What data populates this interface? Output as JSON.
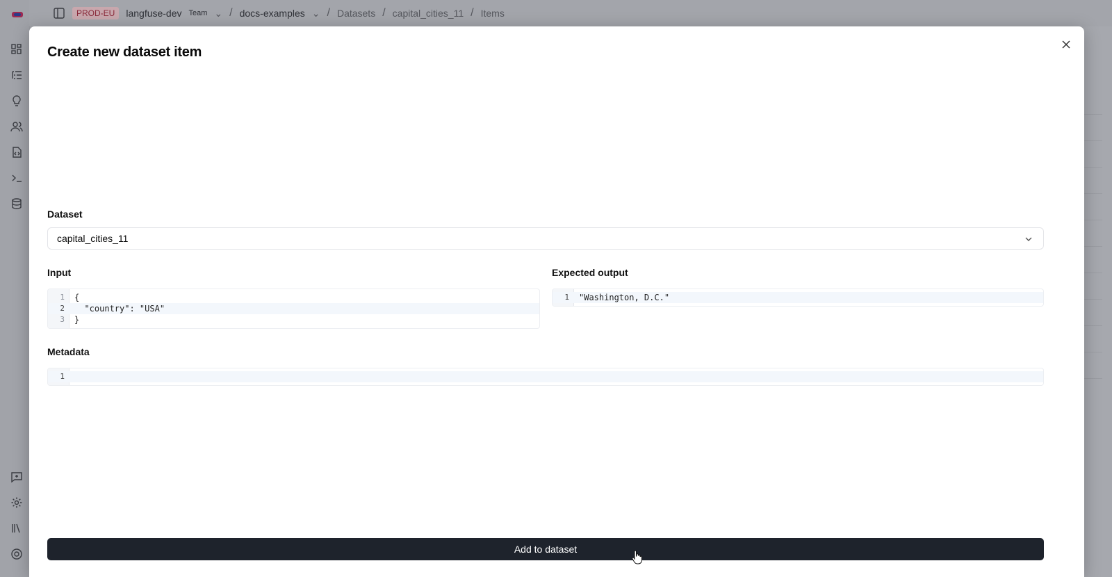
{
  "app": {
    "environment": "PROD-EU",
    "breadcrumb": {
      "org": "langfuse-dev",
      "org_plan": "Team",
      "project": "docs-examples",
      "section": "Datasets",
      "dataset": "capital_cities_11",
      "page": "Items"
    },
    "background_partial_text": "ns"
  },
  "modal": {
    "title": "Create new dataset item",
    "dataset_label": "Dataset",
    "dataset_value": "capital_cities_11",
    "input_label": "Input",
    "input_lines": [
      {
        "num": "1",
        "code": "{"
      },
      {
        "num": "2",
        "code": "  \"country\": \"USA\""
      },
      {
        "num": "3",
        "code": "}"
      }
    ],
    "expected_label": "Expected output",
    "expected_lines": [
      {
        "num": "1",
        "code": "\"Washington, D.C.\""
      }
    ],
    "metadata_label": "Metadata",
    "metadata_lines": [
      {
        "num": "1",
        "code": ""
      }
    ],
    "submit_label": "Add to dataset"
  },
  "icons": {
    "sidebar_top": [
      "dashboard-icon",
      "traces-icon",
      "lightbulb-icon",
      "users-icon",
      "prompt-file-icon",
      "terminal-icon",
      "database-icon"
    ],
    "sidebar_bottom": [
      "feedback-icon",
      "settings-icon",
      "library-icon",
      "support-icon"
    ]
  }
}
